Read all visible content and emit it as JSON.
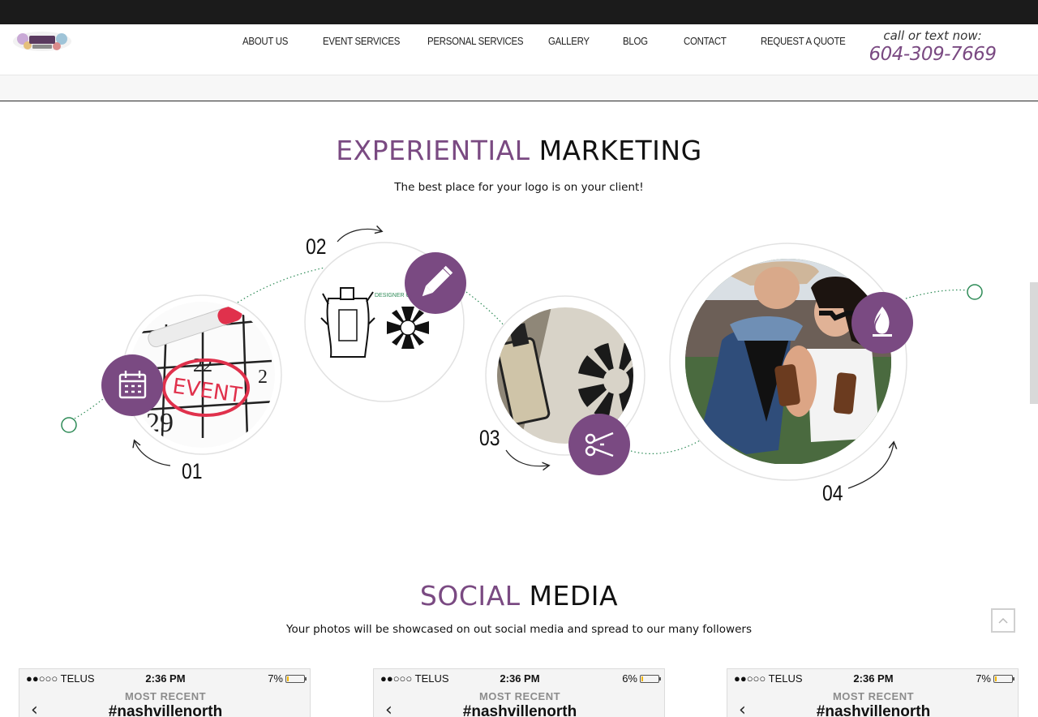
{
  "nav": {
    "items": [
      {
        "label": "ABOUT US"
      },
      {
        "label": "EVENT SERVICES"
      },
      {
        "label": "PERSONAL SERVICES"
      },
      {
        "label": "GALLERY"
      },
      {
        "label": "BLOG"
      },
      {
        "label": "CONTACT"
      },
      {
        "label": "REQUEST A QUOTE"
      }
    ],
    "call_label": "call or text now:",
    "phone": "604-309-7669"
  },
  "experiential": {
    "title_accent": "EXPERIENTIAL",
    "title_dark": "MARKETING",
    "subtitle": "The best place for your logo is on your client!",
    "steps": [
      {
        "number": "01",
        "icon": "calendar-icon"
      },
      {
        "number": "02",
        "icon": "pencil-icon"
      },
      {
        "number": "03",
        "icon": "scissors-icon"
      },
      {
        "number": "04",
        "icon": "flame-icon"
      }
    ],
    "calendar_word": "EVENT"
  },
  "social": {
    "title_accent": "SOCIAL",
    "title_dark": "MEDIA",
    "subtitle": "Your photos will be showcased on out social media and spread to our many followers",
    "phones": [
      {
        "carrier": "●●○○○ TELUS",
        "time": "2:36 PM",
        "battery": "7%",
        "battery_level": 0.07,
        "heading": "MOST RECENT",
        "hashtag": "#nashvillenorth"
      },
      {
        "carrier": "●●○○○ TELUS",
        "time": "2:36 PM",
        "battery": "6%",
        "battery_level": 0.06,
        "heading": "MOST RECENT",
        "hashtag": "#nashvillenorth"
      },
      {
        "carrier": "●●○○○ TELUS",
        "time": "2:36 PM",
        "battery": "7%",
        "battery_level": 0.07,
        "heading": "MOST RECENT",
        "hashtag": "#nashvillenorth"
      }
    ]
  },
  "colors": {
    "accent": "#7a4a82",
    "dark": "#1b1b1b",
    "dot_line": "#2e8b57"
  }
}
